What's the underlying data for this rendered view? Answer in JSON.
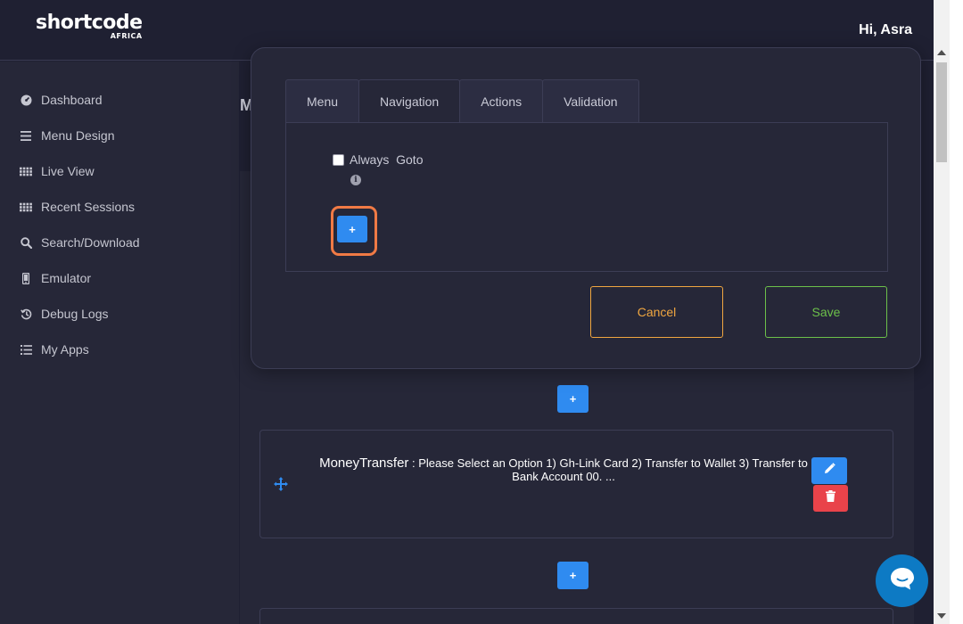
{
  "header": {
    "logo_main": "shortcode",
    "logo_sub": "AFRICA",
    "greeting": "Hi, Asra"
  },
  "sidebar": {
    "items": [
      {
        "label": "Dashboard",
        "icon": "dashboard-icon"
      },
      {
        "label": "Menu Design",
        "icon": "menu-icon"
      },
      {
        "label": "Live View",
        "icon": "grid-icon"
      },
      {
        "label": "Recent Sessions",
        "icon": "grid-icon"
      },
      {
        "label": "Search/Download",
        "icon": "search-icon"
      },
      {
        "label": "Emulator",
        "icon": "phone-icon"
      },
      {
        "label": "Debug Logs",
        "icon": "history-icon"
      },
      {
        "label": "My Apps",
        "icon": "list-icon"
      }
    ]
  },
  "main": {
    "title_letter": "M"
  },
  "modal": {
    "tabs": [
      {
        "label": "Menu",
        "active": false
      },
      {
        "label": "Navigation",
        "active": true
      },
      {
        "label": "Actions",
        "active": false
      },
      {
        "label": "Validation",
        "active": false
      }
    ],
    "always_goto_label": "Always  Goto",
    "always_goto_checked": false,
    "add_label": "+",
    "cancel_label": "Cancel",
    "save_label": "Save"
  },
  "menu_list": {
    "add_label": "+",
    "items": [
      {
        "name": "MoneyTransfer",
        "text": " : Please Select an Option 1) Gh-Link Card 2) Transfer to Wallet 3) Transfer to Bank Account 00. ..."
      }
    ]
  },
  "colors": {
    "primary": "#2f8bf0",
    "danger": "#e9434a",
    "warning": "#f0a640",
    "success": "#6cc04a",
    "highlight": "#f07a45"
  }
}
